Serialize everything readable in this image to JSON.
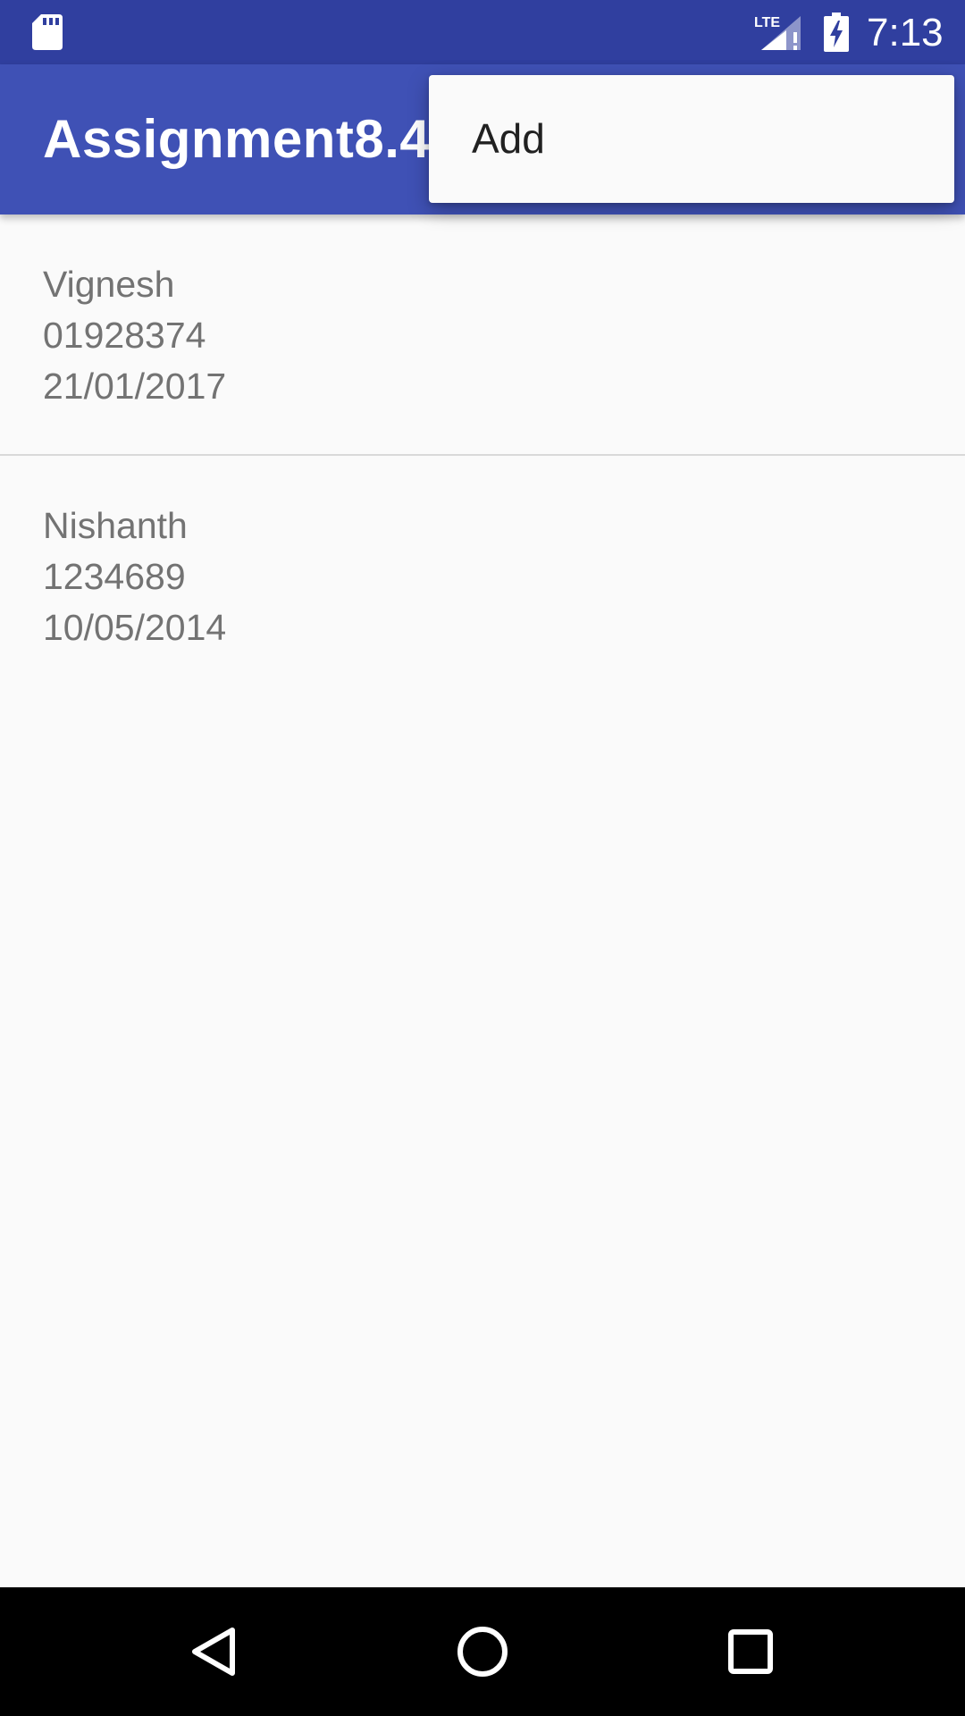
{
  "status_bar": {
    "time": "7:13",
    "network_label": "LTE",
    "icons": [
      "sd-card-icon",
      "lte-signal-icon",
      "battery-charging-icon"
    ]
  },
  "app_bar": {
    "title": "Assignment8.4"
  },
  "overflow_menu": {
    "items": [
      {
        "label": "Add"
      }
    ]
  },
  "list": {
    "items": [
      {
        "name": "Vignesh",
        "phone": "01928374",
        "date": "21/01/2017"
      },
      {
        "name": "Nishanth",
        "phone": "1234689",
        "date": "10/05/2014"
      }
    ]
  },
  "nav_bar": {
    "icons": [
      "back-icon",
      "home-icon",
      "recents-icon"
    ]
  },
  "colors": {
    "status_bar": "#303f9f",
    "app_bar": "#3f51b5",
    "background": "#fafafa",
    "list_text": "#737373",
    "menu_text": "#212121",
    "divider": "#d9d9d9"
  }
}
